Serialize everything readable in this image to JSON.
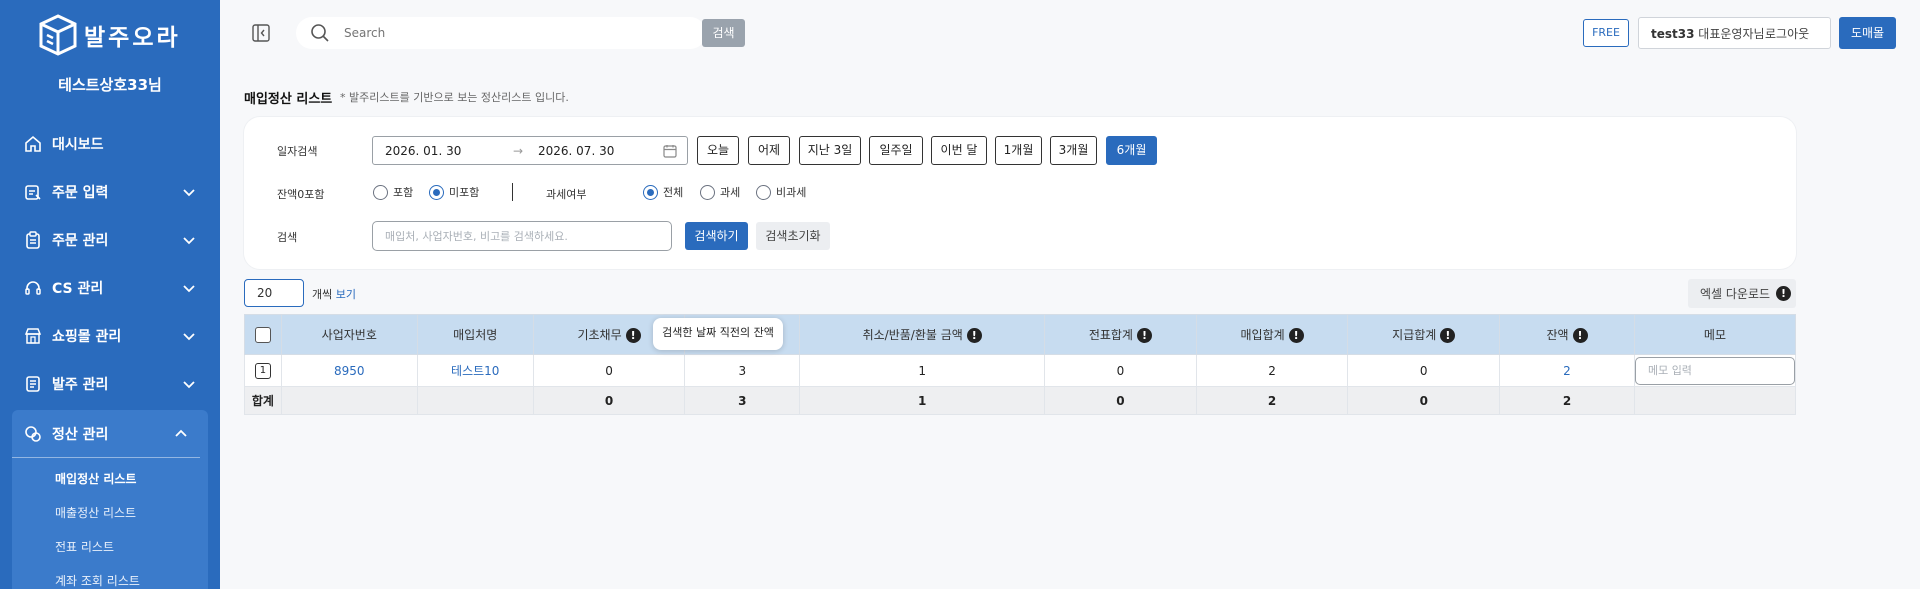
{
  "brand": {
    "logo_text": "발주오라",
    "company": "테스트상호33님",
    "accent": "#2a6bbd"
  },
  "sidebar": {
    "items": [
      {
        "label": "대시보드",
        "icon": "home-icon"
      },
      {
        "label": "주문 입력",
        "icon": "order-entry-icon"
      },
      {
        "label": "주문 관리",
        "icon": "clipboard-icon"
      },
      {
        "label": "CS 관리",
        "icon": "headset-icon"
      },
      {
        "label": "쇼핑몰 관리",
        "icon": "store-icon"
      },
      {
        "label": "발주 관리",
        "icon": "order-icon"
      },
      {
        "label": "정산 관리",
        "icon": "settlement-icon"
      }
    ],
    "sub_items": [
      {
        "label": "매입정산 리스트"
      },
      {
        "label": "매출정산 리스트"
      },
      {
        "label": "전표 리스트"
      },
      {
        "label": "계좌 조회 리스트"
      }
    ]
  },
  "topbar": {
    "search_placeholder": "Search",
    "search_button": "검색",
    "plan": "FREE",
    "user_id": "test33",
    "user_role": "대표운영자님",
    "logout": "로그아웃",
    "wholesale": "도매몰"
  },
  "page": {
    "title": "매입정산 리스트",
    "subtitle": "* 발주리스트를 기반으로 보는 정산리스트 입니다."
  },
  "filters": {
    "date_label": "일자검색",
    "date_from": "2026. 01. 30",
    "date_arrow": "→",
    "date_to": "2026. 07. 30",
    "quick": [
      "오늘",
      "어제",
      "지난 3일",
      "일주일",
      "이번 달",
      "1개월",
      "3개월",
      "6개월"
    ],
    "quick_selected": "6개월",
    "zero_label": "잔액0포함",
    "zero_include": "포함",
    "zero_exclude": "미포함",
    "tax_label": "과세여부",
    "tax_all": "전체",
    "tax_taxed": "과세",
    "tax_free": "비과세",
    "keyword_label": "검색",
    "keyword_placeholder": "매입처, 사업자번호, 비고를 검색하세요.",
    "search_button": "검색하기",
    "reset_button": "검색초기화"
  },
  "list": {
    "page_size": "20",
    "page_size_suffix": "개씩",
    "page_size_view": "보기",
    "excel_button": "엑셀 다운로드",
    "tooltip": "검색한 날짜 직전의 잔액",
    "info_glyph": "!",
    "columns": [
      "사업자번호",
      "매입처명",
      "기초채무",
      "",
      "취소/반품/환불 금액",
      "전표합계",
      "매입합계",
      "지급합계",
      "잔액",
      "메모"
    ],
    "rows": [
      {
        "no": "1",
        "biz_no": "8950",
        "vendor": "테스트10",
        "opening": "0",
        "col4": "3",
        "cancel": "1",
        "voucher": "0",
        "purchase": "2",
        "paid": "0",
        "balance": "2",
        "memo_placeholder": "메모 입력"
      }
    ],
    "total": {
      "label": "합계",
      "opening": "0",
      "col4": "3",
      "cancel": "1",
      "voucher": "0",
      "purchase": "2",
      "paid": "0",
      "balance": "2"
    }
  }
}
